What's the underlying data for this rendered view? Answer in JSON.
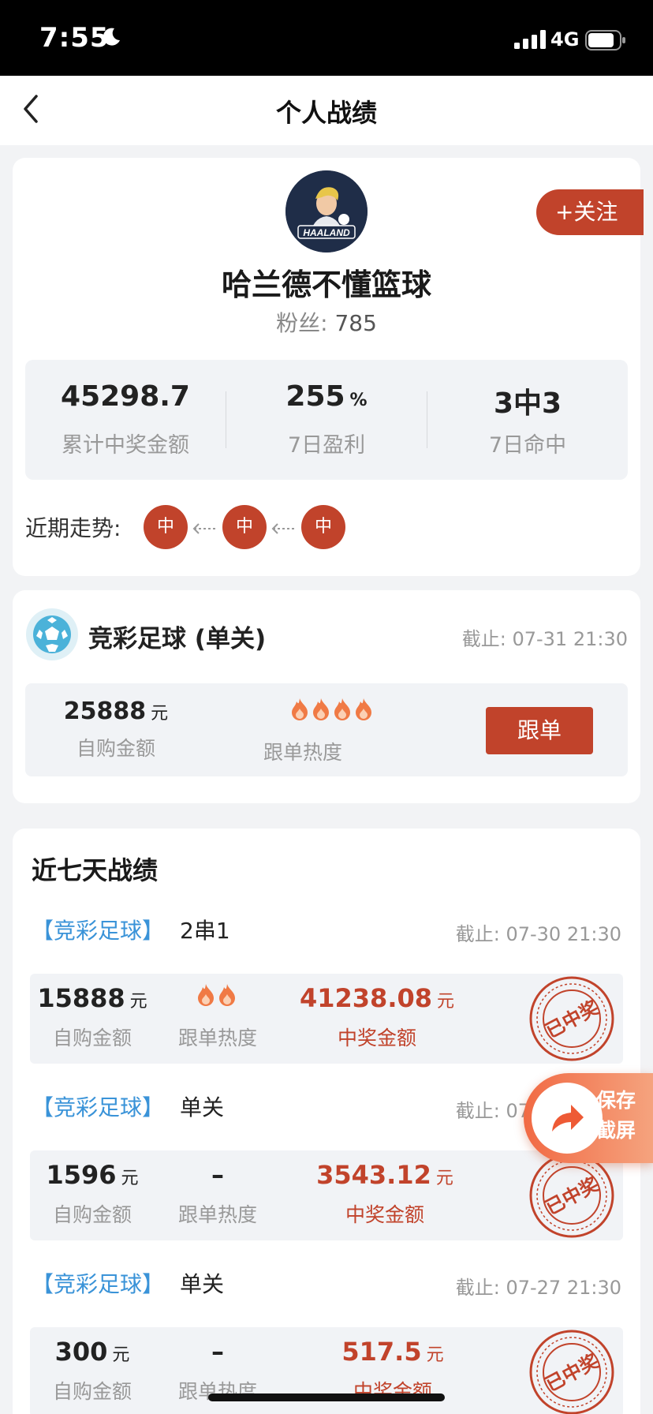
{
  "status_bar": {
    "time": "7:55",
    "network": "4G"
  },
  "nav": {
    "title": "个人战绩"
  },
  "profile": {
    "follow_label": "+关注",
    "name": "哈兰德不懂篮球",
    "fans_label": "粉丝:",
    "fans_count": "785",
    "avatar_text": "HAALAND",
    "stats": [
      {
        "value": "45298.7",
        "unit": "",
        "label": "累计中奖金额"
      },
      {
        "value": "255",
        "unit": "%",
        "label": "7日盈利"
      },
      {
        "value": "3中3",
        "unit": "",
        "label": "7日命中"
      }
    ],
    "trend_label": "近期走势:",
    "trend": [
      "中",
      "中",
      "中"
    ]
  },
  "plan": {
    "title": "竞彩足球 (单关)",
    "deadline": "截止: 07-31 21:30",
    "amount": "25888",
    "yuan": "元",
    "amount_label": "自购金额",
    "heat_label": "跟单热度",
    "heat_level": 4,
    "follow_button": "跟单"
  },
  "records": {
    "title": "近七天战绩",
    "items": [
      {
        "tag": "【竞彩足球】",
        "type": "2串1",
        "deadline": "截止: 07-30 21:30",
        "amount": "15888",
        "yuan": "元",
        "amount_label": "自购金额",
        "heat": "",
        "heat_level": 2,
        "heat_label": "跟单热度",
        "prize": "41238.08",
        "prize_label": "中奖金额",
        "stamp_text": "已中奖"
      },
      {
        "tag": "【竞彩足球】",
        "type": "单关",
        "deadline": "截止: 07-28 21:30",
        "amount": "1596",
        "yuan": "元",
        "amount_label": "自购金额",
        "heat": "–",
        "heat_level": 0,
        "heat_label": "跟单热度",
        "prize": "3543.12",
        "prize_label": "中奖金额",
        "stamp_text": "已中奖"
      },
      {
        "tag": "【竞彩足球】",
        "type": "单关",
        "deadline": "截止: 07-27 21:30",
        "amount": "300",
        "yuan": "元",
        "amount_label": "自购金额",
        "heat": "–",
        "heat_level": 0,
        "heat_label": "跟单热度",
        "prize": "517.5",
        "prize_label": "中奖金额",
        "stamp_text": "已中奖"
      }
    ]
  },
  "float_button": {
    "line1": "保存",
    "line2": "截屏"
  },
  "colors": {
    "accent": "#c1432b",
    "tag_blue": "#3a93d8",
    "panel": "#f1f3f6"
  }
}
